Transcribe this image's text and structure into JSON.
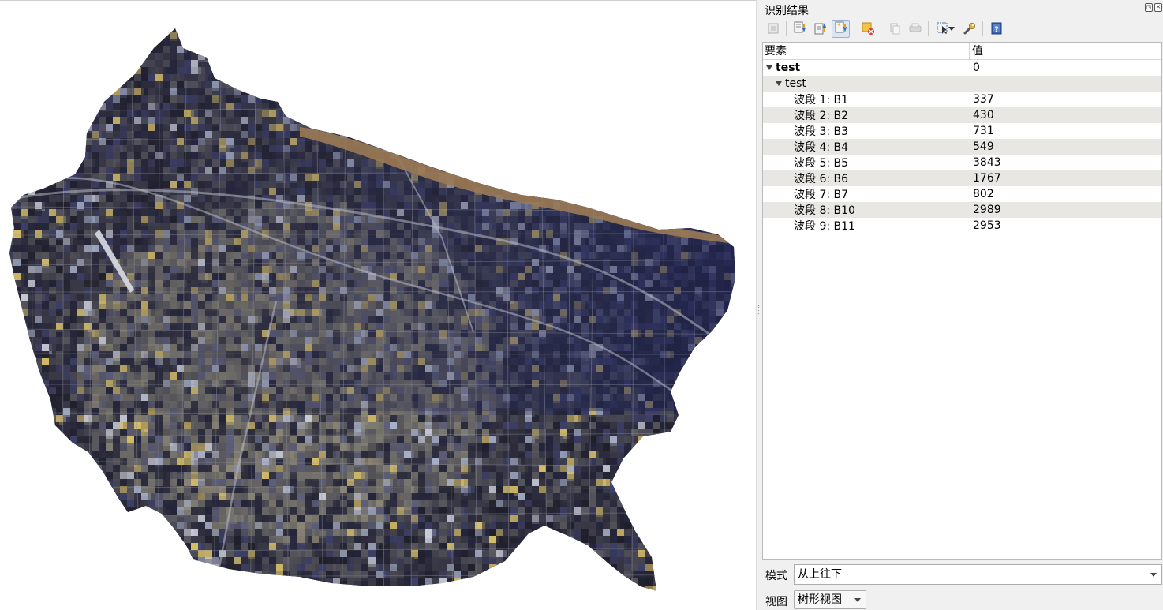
{
  "panel": {
    "title": "识别结果",
    "undock_glyph": "◳",
    "close_glyph": "✕"
  },
  "toolbar": {
    "buttons": [
      {
        "name": "expand-tree-icon",
        "active": false
      },
      {
        "name": "expand-all-icon",
        "active": false
      },
      {
        "name": "collapse-all-icon",
        "active": false
      },
      {
        "name": "expand-new-results-icon",
        "active": true
      },
      {
        "name": "clear-results-icon",
        "active": false
      },
      {
        "name": "copy-icon",
        "active": false
      },
      {
        "name": "print-icon",
        "active": false
      },
      {
        "name": "select-mode-icon",
        "active": false
      },
      {
        "name": "settings-icon",
        "active": false
      },
      {
        "name": "help-icon",
        "active": false
      }
    ]
  },
  "tree": {
    "header": {
      "feature": "要素",
      "value": "值"
    },
    "layer": {
      "name": "test",
      "value": "0"
    },
    "feature": {
      "name": "test"
    },
    "bands": [
      {
        "label": "波段 1: B1",
        "value": "337"
      },
      {
        "label": "波段 2: B2",
        "value": "430"
      },
      {
        "label": "波段 3: B3",
        "value": "731"
      },
      {
        "label": "波段 4: B4",
        "value": "549"
      },
      {
        "label": "波段 5: B5",
        "value": "3843"
      },
      {
        "label": "波段 6: B6",
        "value": "1767"
      },
      {
        "label": "波段 7: B7",
        "value": "802"
      },
      {
        "label": "波段 8: B10",
        "value": "2989"
      },
      {
        "label": "波段 9: B11",
        "value": "2953"
      }
    ]
  },
  "mode": {
    "label": "模式",
    "value": "从上往下"
  },
  "view": {
    "label": "视图",
    "value": "树形视图"
  },
  "map": {
    "background": "#ffffff",
    "base_color": "#2a2a3a",
    "river_color": "#9b7a55"
  }
}
